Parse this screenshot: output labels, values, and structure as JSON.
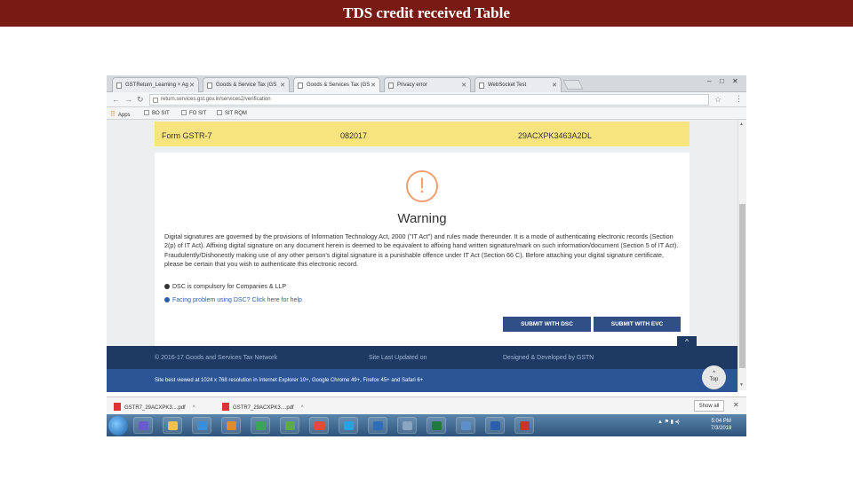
{
  "slide": {
    "title": "TDS credit received Table"
  },
  "browser": {
    "tabs": [
      {
        "label": "GSTReturn_Learning × Ag",
        "active": false
      },
      {
        "label": "Goods & Service Tax (GS",
        "active": false
      },
      {
        "label": "Goods & Services Tax (GS",
        "active": true
      },
      {
        "label": "Privacy error",
        "active": false
      },
      {
        "label": "WebSocket Test",
        "active": false
      }
    ],
    "url": "return.services.gst.gov.in/services2/verification",
    "bookmarks": [
      {
        "label": "Apps",
        "icon": "apps-grid-icon"
      },
      {
        "label": "BO SIT",
        "icon": "page-icon"
      },
      {
        "label": "FO SIT",
        "icon": "page-icon"
      },
      {
        "label": "SIT RQM",
        "icon": "page-icon"
      }
    ]
  },
  "form_header": {
    "form": "Form GSTR-7",
    "period": "082017",
    "gstin": "29ACXPK3463A2DL"
  },
  "warning": {
    "icon_glyph": "!",
    "title": "Warning",
    "text": "Digital signatures are governed by the provisions of Information Technology Act, 2000 (\"IT Act\") and rules made thereunder. It is a mode of authenticating electronic records (Section 2(p) of IT Act). Affixing digital signature on any document herein is deemed to be equivalent to affixing hand written signature/mark on such information/document (Section 5 of IT Act). Fraudulently/Dishonestly making use of any other person's digital signature is a punishable offence under IT Act (Section 66 C). Before attaching your digital signature certificate, please be certain that you wish to authenticate this electronic record.",
    "note_dsc": "DSC is compulsory for Companies & LLP",
    "note_help": "Facing problem using DSC? Click here for help"
  },
  "buttons": {
    "submit_dsc": "SUBMIT WITH DSC",
    "submit_evc": "SUBMIT WITH EVC"
  },
  "footer": {
    "copyright": "© 2016-17 Goods and Services Tax Network",
    "updated": "Site Last Updated on",
    "designed": "Designed & Developed by GSTN",
    "best_viewed": "Site best viewed at 1024 x 768 resolution in Internet Explorer 10+, Google Chrome 49+, Firefox 45+ and Safari 6+",
    "top_label": "Top"
  },
  "downloads": {
    "items": [
      "GSTR7_29ACXPK3....pdf",
      "GSTR7_29ACXPK3....pdf"
    ],
    "show_all": "Show all"
  },
  "taskbar": {
    "time": "5:04 PM",
    "date": "7/3/2018",
    "app_icons": [
      "vs-icon",
      "folder-icon",
      "ie-icon",
      "media-icon",
      "refresh-icon",
      "chart-icon",
      "chrome-icon",
      "skype-icon",
      "outlook-icon",
      "app-icon",
      "excel-icon",
      "network-icon",
      "word-icon",
      "acrobat-icon"
    ]
  },
  "colors": {
    "title_bar": "#7a1a14",
    "form_header": "#f7e47e",
    "button": "#2f4f86",
    "footer_dark": "#1e3a63",
    "footer_light": "#2c5596"
  }
}
